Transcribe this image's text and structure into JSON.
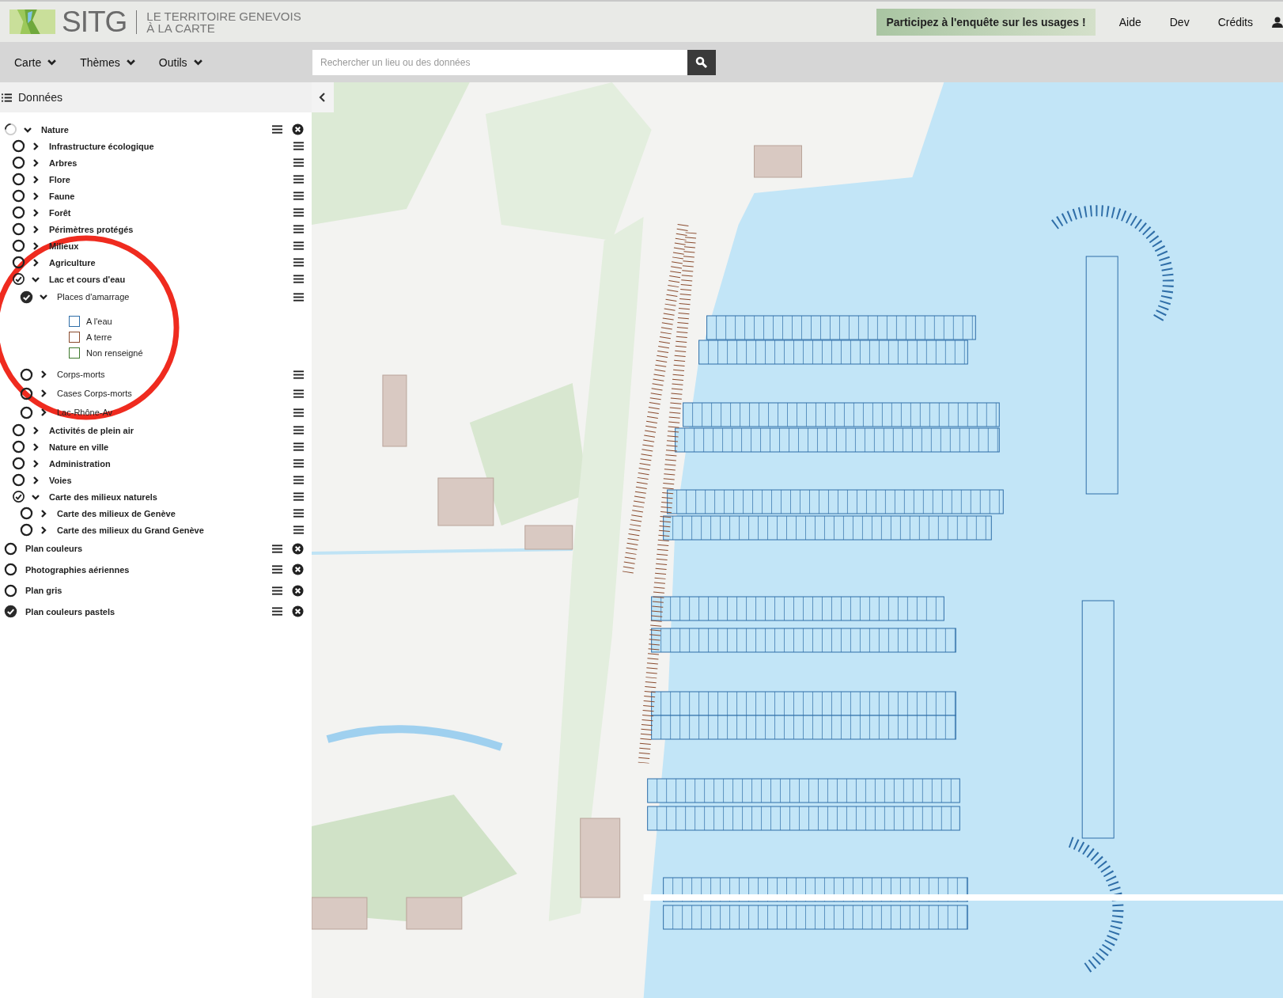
{
  "header": {
    "logo_text": "SITG",
    "tagline_lines": [
      "LE TERRITOIRE GENEVOIS",
      "À LA CARTE"
    ],
    "survey_button": "Participez à l'enquête sur les usages !",
    "links": [
      "Aide",
      "Dev",
      "Crédits"
    ]
  },
  "toolbar": {
    "menus": [
      "Carte",
      "Thèmes",
      "Outils"
    ],
    "search": {
      "placeholder": "Rechercher un lieu ou des données"
    }
  },
  "panel": {
    "title": "Données",
    "layers": [
      {
        "kind": "theme",
        "label": "Nature",
        "loading": true,
        "expanded": true,
        "removable": true,
        "children": [
          {
            "kind": "theme",
            "label": "Infrastructure écologique",
            "checked": false,
            "expanded": false
          },
          {
            "kind": "theme",
            "label": "Arbres",
            "checked": false,
            "expanded": false
          },
          {
            "kind": "theme",
            "label": "Flore",
            "checked": false,
            "expanded": false
          },
          {
            "kind": "theme",
            "label": "Faune",
            "checked": false,
            "expanded": false
          },
          {
            "kind": "theme",
            "label": "Forêt",
            "checked": false,
            "expanded": false
          },
          {
            "kind": "theme",
            "label": "Périmètres protégés",
            "checked": false,
            "expanded": false
          },
          {
            "kind": "theme",
            "label": "Milieux",
            "checked": false,
            "expanded": false
          },
          {
            "kind": "theme",
            "label": "Agriculture",
            "checked": false,
            "expanded": false
          },
          {
            "kind": "theme",
            "label": "Lac et cours d'eau",
            "checked": true,
            "partial": true,
            "expanded": true,
            "children": [
              {
                "kind": "layer",
                "label": "Places d'amarrage",
                "checked": true,
                "expanded": true,
                "children": [
                  {
                    "kind": "legend",
                    "label": "A l'eau",
                    "color": "#2f6ea8"
                  },
                  {
                    "kind": "legend",
                    "label": "A terre",
                    "color": "#8a4b2e"
                  },
                  {
                    "kind": "legend",
                    "label": "Non renseigné",
                    "color": "#3f7a2e"
                  }
                ]
              },
              {
                "kind": "layer",
                "label": "Corps-morts",
                "checked": false,
                "expanded": false
              },
              {
                "kind": "layer",
                "label": "Cases Corps-morts",
                "checked": false,
                "expanded": false
              },
              {
                "kind": "layer",
                "label": "Lac-Rhône-Av",
                "checked": false,
                "expanded": false
              }
            ]
          },
          {
            "kind": "theme",
            "label": "Activités de plein air",
            "checked": false,
            "expanded": false
          },
          {
            "kind": "theme",
            "label": "Nature en ville",
            "checked": false,
            "expanded": false
          },
          {
            "kind": "theme",
            "label": "Administration",
            "checked": false,
            "expanded": false
          },
          {
            "kind": "theme",
            "label": "Voies",
            "checked": false,
            "expanded": false
          },
          {
            "kind": "theme",
            "label": "Carte des milieux naturels",
            "checked": true,
            "partial": true,
            "expanded": true,
            "children": [
              {
                "kind": "theme",
                "label": "Carte des milieux de Genève",
                "checked": false,
                "expanded": false
              },
              {
                "kind": "theme",
                "label": "Carte des milieux du Grand Genève",
                "checked": false,
                "expanded": false
              }
            ]
          }
        ]
      },
      {
        "kind": "basemap",
        "label": "Plan couleurs",
        "checked": false,
        "removable": true
      },
      {
        "kind": "basemap",
        "label": "Photographies aériennes",
        "checked": false,
        "removable": true
      },
      {
        "kind": "basemap",
        "label": "Plan gris",
        "checked": false,
        "removable": true
      },
      {
        "kind": "basemap",
        "label": "Plan couleurs pastels",
        "checked": true,
        "removable": true
      }
    ]
  }
}
